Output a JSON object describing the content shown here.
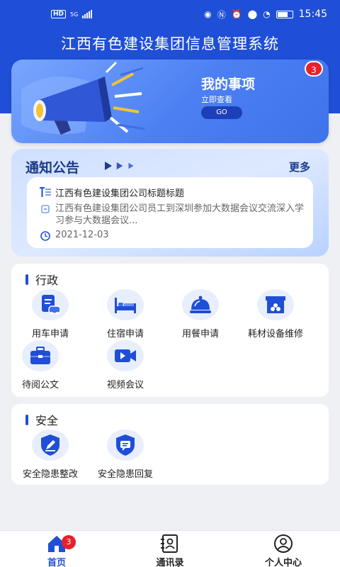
{
  "status_bar": {
    "hd": "HD",
    "network": "5G",
    "time": "15:45"
  },
  "app_title": "江西有色建设集团信息管理系统",
  "banner": {
    "title": "我的事项",
    "subtitle": "立即查看",
    "go_label": "GO",
    "badge_count": "3"
  },
  "notice": {
    "title": "通知公告",
    "more_label": "更多",
    "item_title": "江西有色建设集团公司标题标题",
    "item_desc": "江西有色建设集团公司员工到深圳参加大数据会议交流深入学习参与大数据会议...",
    "item_date": "2021-12-03"
  },
  "admin": {
    "title": "行政",
    "items": [
      {
        "label": "用车申请",
        "icon": "car-document-icon"
      },
      {
        "label": "住宿申请",
        "icon": "bed-icon"
      },
      {
        "label": "用餐申请",
        "icon": "dining-bell-icon"
      },
      {
        "label": "耗材设备维修",
        "icon": "toolbox-icon"
      },
      {
        "label": "待阅公文",
        "icon": "briefcase-icon"
      },
      {
        "label": "视频会议",
        "icon": "video-icon"
      }
    ]
  },
  "safety": {
    "title": "安全",
    "items": [
      {
        "label": "安全隐患整改",
        "icon": "shield-pen-icon"
      },
      {
        "label": "安全隐患回复",
        "icon": "shield-chat-icon"
      }
    ]
  },
  "bottom_nav": {
    "items": [
      {
        "label": "首页",
        "icon": "home-icon",
        "badge": "3"
      },
      {
        "label": "通讯录",
        "icon": "contacts-icon"
      },
      {
        "label": "个人中心",
        "icon": "user-icon"
      }
    ]
  },
  "colors": {
    "primary": "#1f4fd6",
    "badge": "#e8202a",
    "background": "#eef0f4"
  }
}
